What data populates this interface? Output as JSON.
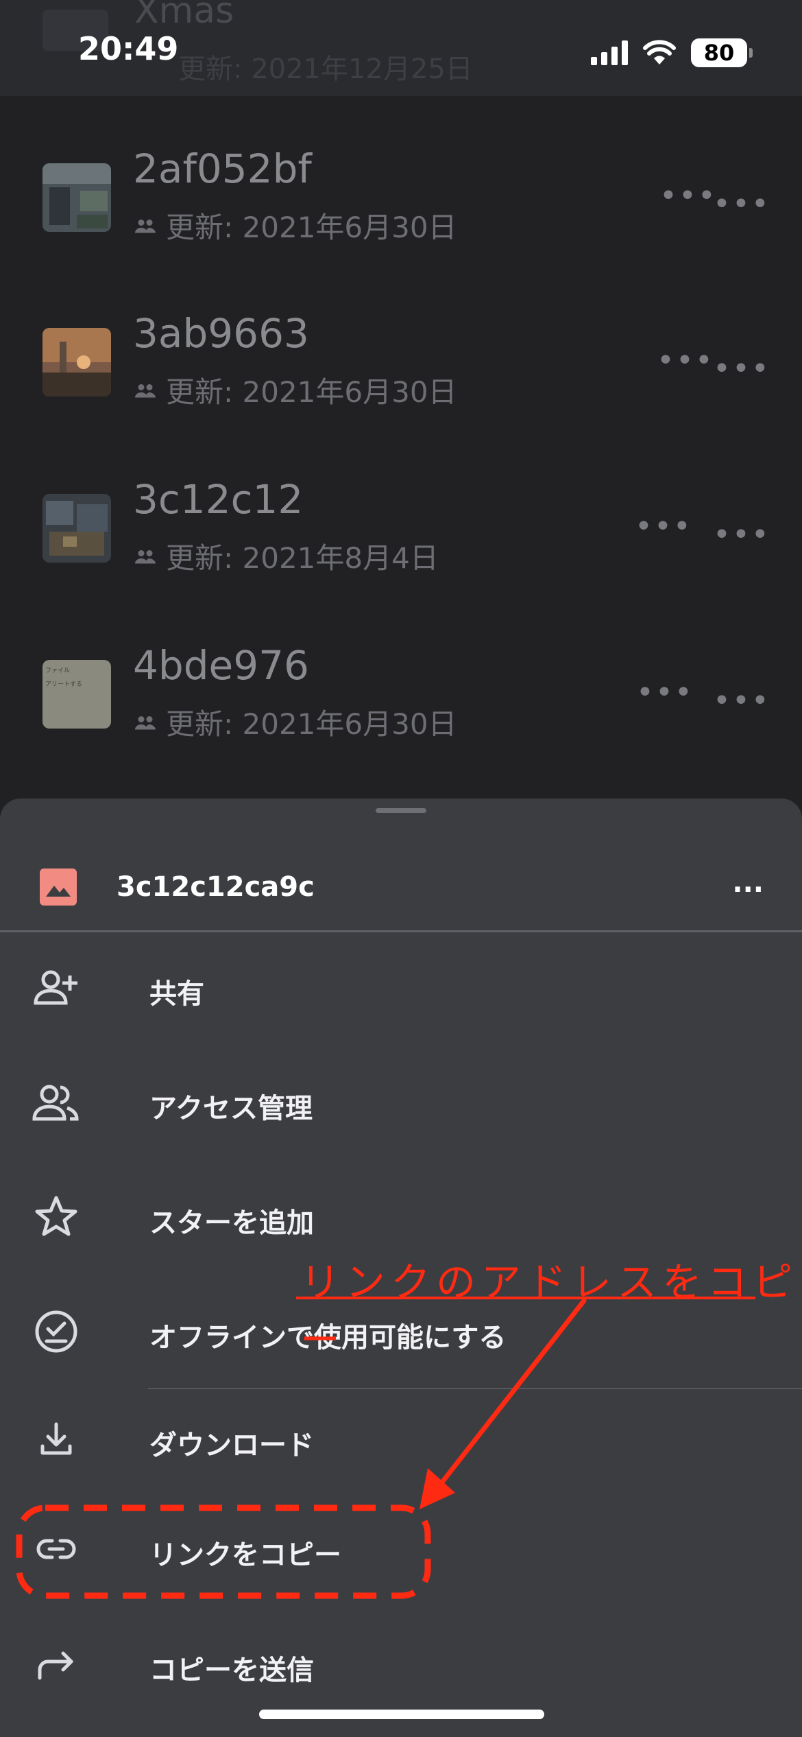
{
  "status_bar": {
    "time": "20:49",
    "battery": "80"
  },
  "background_header": {
    "title": "Xmas",
    "subtitle": "更新: 2021年12月25日"
  },
  "files": [
    {
      "name": "2af052bf",
      "meta": "更新: 2021年6月30日"
    },
    {
      "name": "3ab9663",
      "meta": "更新: 2021年6月30日"
    },
    {
      "name": "3c12c12",
      "meta": "更新: 2021年8月4日"
    },
    {
      "name": "4bde976",
      "meta": "更新: 2021年6月30日",
      "thumb_lines": [
        "ファイル",
        "アリートする"
      ]
    }
  ],
  "sheet": {
    "title": "3c12c12ca9c",
    "more": "...",
    "menu": [
      {
        "label": "共有",
        "icon": "person-add-icon"
      },
      {
        "label": "アクセス管理",
        "icon": "people-icon"
      },
      {
        "label": "スターを追加",
        "icon": "star-icon"
      },
      {
        "label": "オフラインで使用可能にする",
        "icon": "offline-check-icon"
      },
      {
        "label": "ダウンロード",
        "icon": "download-icon"
      },
      {
        "label": "リンクをコピー",
        "icon": "link-icon"
      },
      {
        "label": "コピーを送信",
        "icon": "share-arrow-icon"
      }
    ]
  },
  "annotation": {
    "text": "リンクのアドレスをコピー",
    "color": "#ff2a12"
  },
  "colors": {
    "background": "#212124",
    "sheet": "#3c3d41",
    "image_icon": "#f28b82"
  }
}
